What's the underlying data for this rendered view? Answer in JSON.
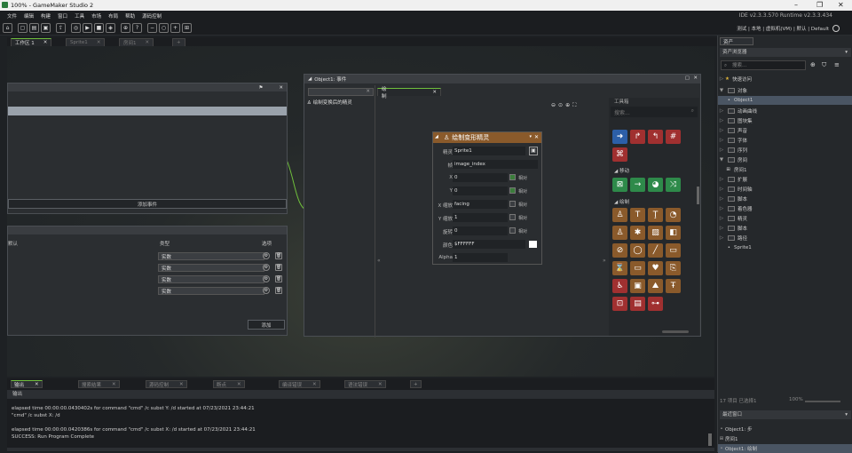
{
  "window": {
    "title": "100% - GameMaker Studio 2"
  },
  "menu": [
    "文件",
    "编辑",
    "构建",
    "窗口",
    "工具",
    "市场",
    "布局",
    "帮助",
    "源码控制"
  ],
  "ide": {
    "version": "IDE v2.3.3.570  Runtime v2.3.3.434",
    "right_toolbar": "测试 | 本地 | 虚拟机(VM) | 默认 | Default"
  },
  "tabs": [
    {
      "label": "工作区 1",
      "active": true
    },
    {
      "label": "Sprite1",
      "active": false
    },
    {
      "label": "房间1",
      "active": false
    }
  ],
  "object_events": {
    "add_event": "添加事件"
  },
  "variables": {
    "col_default": "默认",
    "col_type": "类型",
    "col_options": "选项",
    "type_value": "实数",
    "add": "添加",
    "rows": 4
  },
  "object_editor": {
    "title": "Object1: 事件",
    "tab_label": "绘制",
    "event_item": "绘制变换后的精灵",
    "toolbox_title": "工具箱",
    "toolbox_search": "搜索...",
    "section_movement": "移动",
    "section_draw": "绘制"
  },
  "draw_action": {
    "title": "绘制变形精灵",
    "fields": [
      {
        "label": "精灵",
        "value": "Sprite1",
        "check": null
      },
      {
        "label": "帧",
        "value": "image_index",
        "check": null
      },
      {
        "label": "X",
        "value": "0",
        "check": true
      },
      {
        "label": "Y",
        "value": "0",
        "check": true
      },
      {
        "label": "X 缩放",
        "value": "facing",
        "check": false
      },
      {
        "label": "Y 缩放",
        "value": "1",
        "check": false
      },
      {
        "label": "旋转",
        "value": "0",
        "check": false
      },
      {
        "label": "颜色",
        "value": "$FFFFFF",
        "check": null
      },
      {
        "label": "Alpha",
        "value": "1",
        "check": null
      }
    ],
    "relative": "相对"
  },
  "assets": {
    "title": "资产",
    "browser": "资产浏览器",
    "search": "搜索...",
    "quick_access": "快速访问",
    "tree": [
      {
        "label": "对象",
        "depth": 0,
        "open": true
      },
      {
        "label": "Object1",
        "depth": 1,
        "selected": true
      },
      {
        "label": "动画曲线",
        "depth": 0
      },
      {
        "label": "图块集",
        "depth": 0
      },
      {
        "label": "扩展",
        "depth": 0
      },
      {
        "label": "声音",
        "depth": 0
      },
      {
        "label": "字体",
        "depth": 0
      },
      {
        "label": "序列",
        "depth": 0
      },
      {
        "label": "房间",
        "depth": 0,
        "open": true
      },
      {
        "label": "房间1",
        "depth": 1
      },
      {
        "label": "扩展",
        "depth": 0
      },
      {
        "label": "时间轴",
        "depth": 0
      },
      {
        "label": "脚本",
        "depth": 0
      },
      {
        "label": "着色器",
        "depth": 0
      },
      {
        "label": "精灵",
        "depth": 0
      },
      {
        "label": "脚本",
        "depth": 0
      },
      {
        "label": "路径",
        "depth": 0,
        "open": true
      },
      {
        "label": "Sprite1",
        "depth": 1
      }
    ],
    "footer_items": "17 项目  已选择1",
    "zoom": "100%",
    "recent_title": "最近窗口",
    "recent": [
      "Object1: 步",
      "房间1",
      "Object1: 绘制"
    ]
  },
  "output": {
    "tabs": [
      "输出",
      "搜索结果",
      "源码控制",
      "断点",
      "编译错误",
      "语法错误"
    ],
    "title": "输出",
    "lines": [
      "elapsed time 00:00:00.0430402s for command \"cmd\" /c subst Y: /d started at 07/23/2021 23:44:21",
      "\"cmd\" /c subst X: /d",
      "elapsed time 00:00:00.0420386s for command \"cmd\" /c subst X: /d started at 07/23/2021 23:44:21",
      "SUCCESS: Run Program Complete"
    ]
  }
}
